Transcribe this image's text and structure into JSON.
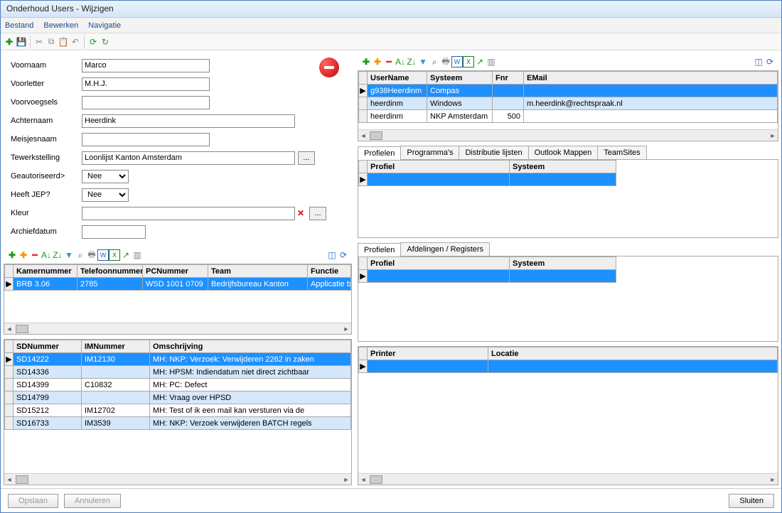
{
  "window": {
    "title": "Onderhoud Users - Wijzigen"
  },
  "menu": {
    "bestand": "Bestand",
    "bewerken": "Bewerken",
    "navigatie": "Navigatie"
  },
  "form": {
    "labels": {
      "voornaam": "Voornaam",
      "voorletter": "Voorletter",
      "voorvoegsels": "Voorvoegsels",
      "achternaam": "Achternaam",
      "meisjesnaam": "Meisjesnaam",
      "tewerkstelling": "Tewerkstelling",
      "geautoriseerd": "Geautoriseerd>",
      "heeft_jep": "Heeft JEP?",
      "kleur": "Kleur",
      "archiefdatum": "Archiefdatum"
    },
    "values": {
      "voornaam": "Marco",
      "voorletter": "M.H.J.",
      "voorvoegsels": "",
      "achternaam": "Heerdink",
      "meisjesnaam": "",
      "tewerkstelling": "Loonlijst Kanton Amsterdam",
      "geautoriseerd": "Nee",
      "heeft_jep": "Nee",
      "kleur": "",
      "archiefdatum": ""
    }
  },
  "grid_kamer": {
    "headers": {
      "kamernummer": "Kamernummer",
      "telefoon": "Telefoonnummer",
      "pcnummer": "PCNummer",
      "team": "Team",
      "functie": "Functie"
    },
    "rows": [
      {
        "kamernummer": "BRB 3.06",
        "telefoon": "2785",
        "pcnummer": "WSD 1001 0709",
        "team": "Bedrijfsbureau Kanton",
        "functie": "Applicatie be"
      }
    ]
  },
  "grid_sd": {
    "headers": {
      "sdnummer": "SDNummer",
      "imnummer": "IMNummer",
      "omschrijving": "Omschrijving"
    },
    "rows": [
      {
        "sd": "SD14222",
        "im": "IM12130",
        "om": "MH: NKP: Verzoek: Verwijderen 2262 in zaken"
      },
      {
        "sd": "SD14336",
        "im": "",
        "om": "MH: HPSM: Indiendatum niet direct zichtbaar"
      },
      {
        "sd": "SD14399",
        "im": "C10832",
        "om": "MH: PC: Defect"
      },
      {
        "sd": "SD14799",
        "im": "",
        "om": "MH: Vraag over HPSD"
      },
      {
        "sd": "SD15212",
        "im": "IM12702",
        "om": "MH: Test of ik een mail kan versturen via de"
      },
      {
        "sd": "SD16733",
        "im": "IM3539",
        "om": "MH: NKP: Verzoek verwijderen BATCH regels"
      }
    ]
  },
  "grid_users": {
    "headers": {
      "username": "UserName",
      "systeem": "Systeem",
      "fnr": "Fnr",
      "email": "EMail"
    },
    "rows": [
      {
        "username": "g938Heerdinm",
        "systeem": "Compas",
        "fnr": "",
        "email": ""
      },
      {
        "username": "heerdinm",
        "systeem": "Windows",
        "fnr": "",
        "email": "m.heerdink@rechtspraak.nl"
      },
      {
        "username": "heerdinm",
        "systeem": "NKP Amsterdam",
        "fnr": "500",
        "email": ""
      }
    ]
  },
  "tabs1": {
    "profielen": "Profielen",
    "programmas": "Programma's",
    "distributie": "Distributie lijsten",
    "outlook": "Outlook Mappen",
    "teamsites": "TeamSites"
  },
  "tabs2": {
    "profielen": "Profielen",
    "afdelingen": "Afdelingen / Registers"
  },
  "grid_profiel": {
    "headers": {
      "profiel": "Profiel",
      "systeem": "Systeem"
    }
  },
  "grid_printer": {
    "headers": {
      "printer": "Printer",
      "locatie": "Locatie"
    }
  },
  "footer": {
    "opslaan": "Opslaan",
    "annuleren": "Annuleren",
    "sluiten": "Sluiten"
  }
}
